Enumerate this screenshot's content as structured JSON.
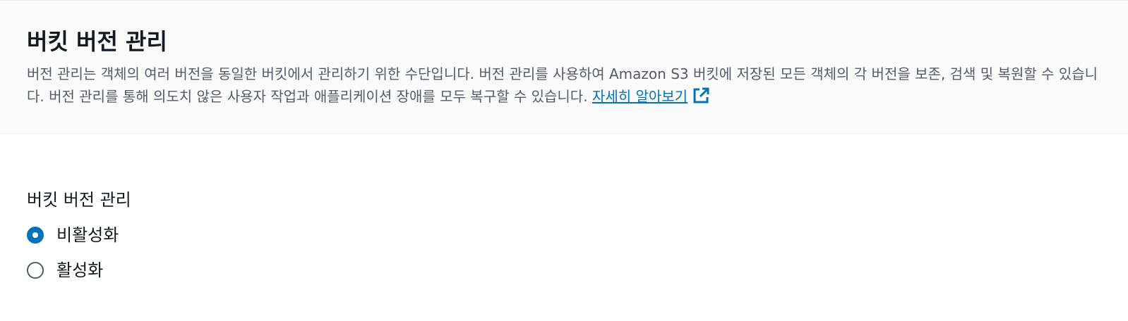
{
  "header": {
    "title": "버킷 버전 관리",
    "description": "버전 관리는 객체의 여러 버전을 동일한 버킷에서 관리하기 위한 수단입니다. 버전 관리를 사용하여 Amazon S3 버킷에 저장된 모든 객체의 각 버전을 보존, 검색 및 복원할 수 있습니다. 버전 관리를 통해 의도치 않은 사용자 작업과 애플리케이션 장애를 모두 복구할 수 있습니다.",
    "learn_more_label": "자세히 알아보기",
    "learn_more_icon": "external-link-icon"
  },
  "versioning": {
    "label": "버킷 버전 관리",
    "options": [
      {
        "label": "비활성화",
        "selected": true
      },
      {
        "label": "활성화",
        "selected": false
      }
    ]
  },
  "colors": {
    "accent": "#0073bb",
    "header_bg": "#fafafa",
    "text": "#16191f",
    "muted_text": "#545b64"
  }
}
